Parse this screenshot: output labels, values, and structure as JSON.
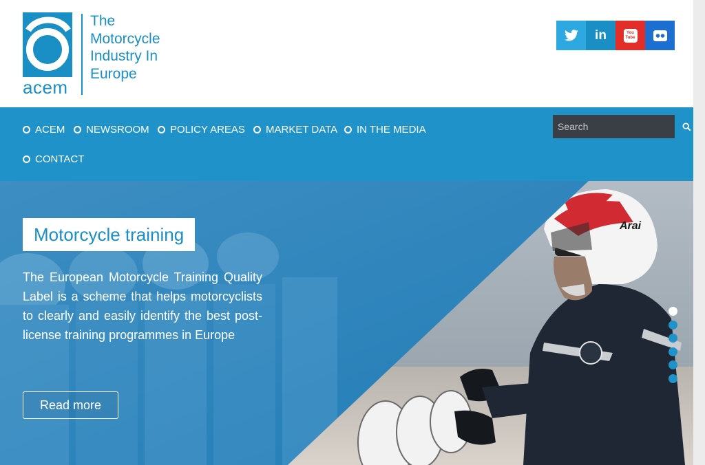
{
  "brand": {
    "wordmark": "acem",
    "tagline": "The\nMotorcycle\nIndustry In\nEurope",
    "color": "#1a8fc5"
  },
  "social": [
    {
      "name": "twitter",
      "icon": "twitter-icon",
      "color": "#2ea8e0"
    },
    {
      "name": "linkedin",
      "icon": "linkedin-icon",
      "label": "in",
      "color": "#1a8fc5"
    },
    {
      "name": "youtube",
      "icon": "youtube-icon",
      "label_top": "You",
      "label_bottom": "Tube",
      "color": "#e22d28"
    },
    {
      "name": "flickr",
      "icon": "flickr-icon",
      "color": "#1c6fd1"
    }
  ],
  "nav": {
    "items": [
      {
        "label": "ACEM"
      },
      {
        "label": "NEWSROOM"
      },
      {
        "label": "POLICY AREAS"
      },
      {
        "label": "MARKET DATA"
      },
      {
        "label": "IN THE MEDIA"
      },
      {
        "label": "CONTACT"
      }
    ],
    "search": {
      "placeholder": "Search",
      "value": ""
    },
    "background": "#1f93c9"
  },
  "hero": {
    "title": "Motorcycle training",
    "text": "The European Motorcycle Training Quality Label is a scheme that helps motorcyclists to clearly and easily identify the best post-license training programmes in Europe",
    "button_label": "Read more",
    "slides_total": 6,
    "active_slide": 1,
    "helmet_text": "Arai"
  }
}
